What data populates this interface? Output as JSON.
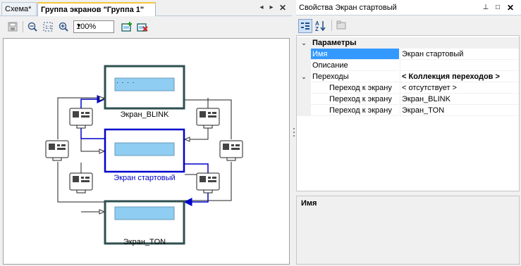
{
  "tabs": [
    {
      "label": "Схема*"
    },
    {
      "label": "Группа экранов \"Группа 1\""
    }
  ],
  "toolbar": {
    "zoom_value": "100%"
  },
  "screens": [
    {
      "label": "Экран_BLINK",
      "dots": "· · · ·"
    },
    {
      "label": "Экран стартовый"
    },
    {
      "label": "Экран_TON"
    }
  ],
  "props": {
    "title": "Свойства Экран стартовый",
    "rows": [
      {
        "name": "Параметры",
        "value": ""
      },
      {
        "name": "Имя",
        "value": "Экран стартовый"
      },
      {
        "name": "Описание",
        "value": ""
      },
      {
        "name": "Переходы",
        "value": "< Коллекция переходов >"
      },
      {
        "name": "Переход к экрану",
        "value": "< отсутствует >"
      },
      {
        "name": "Переход к экрану",
        "value": "Экран_BLINK"
      },
      {
        "name": "Переход к экрану",
        "value": "Экран_TON"
      }
    ],
    "description_title": "Имя"
  },
  "colors": {
    "selected_blue": "#0000cc",
    "screen_fill": "#8fcdf2",
    "screen_border": "#2f4f4f",
    "selection": "#3399ff"
  }
}
